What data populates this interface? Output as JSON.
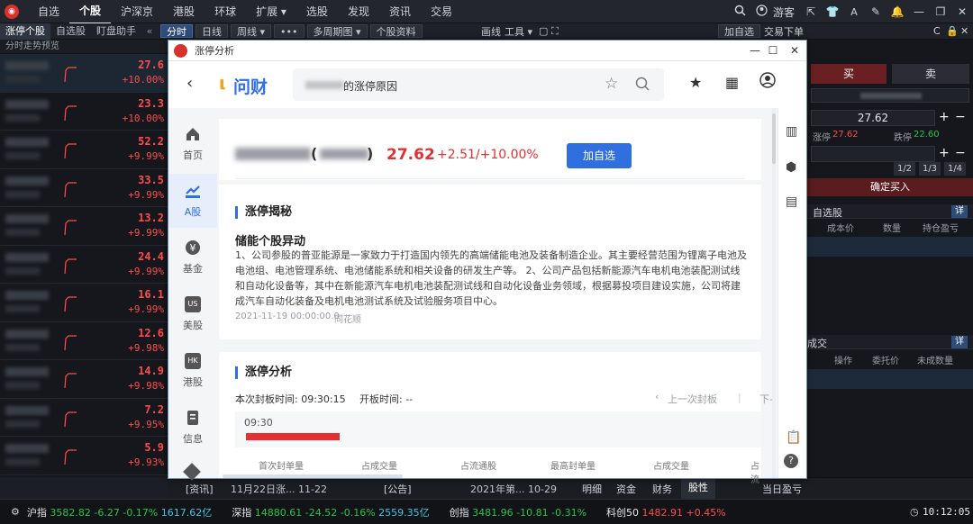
{
  "topbar": {
    "menu": [
      "自选",
      "个股",
      "沪深京",
      "港股",
      "环球",
      "扩展 ▾",
      "选股",
      "发现",
      "资讯",
      "交易"
    ],
    "active_index": 1,
    "user_label": "游客"
  },
  "row2": {
    "left_tabs": [
      "涨停个股",
      "自选股",
      "盯盘助手"
    ],
    "pills": [
      "分时",
      "日线",
      "周线 ▾",
      "•••",
      "多周期图 ▾",
      "个股资料"
    ],
    "right_items": [
      "画线",
      "工具 ▾",
      "▢",
      "⛶"
    ],
    "add_watch": "加自选",
    "trade_order": "交易下单"
  },
  "leftpanel": {
    "subheader": "分时走势预览",
    "rows": [
      {
        "price": "27.6",
        "pct": "+10.00%"
      },
      {
        "price": "23.3",
        "pct": "+10.00%"
      },
      {
        "price": "52.2",
        "pct": "+9.99%"
      },
      {
        "price": "33.5",
        "pct": "+9.99%"
      },
      {
        "price": "13.2",
        "pct": "+9.99%"
      },
      {
        "price": "24.4",
        "pct": "+9.99%"
      },
      {
        "price": "16.1",
        "pct": "+9.99%"
      },
      {
        "price": "12.6",
        "pct": "+9.98%"
      },
      {
        "price": "14.9",
        "pct": "+9.98%"
      },
      {
        "price": "7.2",
        "pct": "+9.95%"
      },
      {
        "price": "5.9",
        "pct": "+9.93%"
      }
    ]
  },
  "modal": {
    "title": "涨停分析",
    "brand": "问财",
    "search_text": "的涨停原因",
    "side_items": [
      "首页",
      "A股",
      "基金",
      "美股",
      "港股",
      "信息"
    ],
    "side_badges": {
      "us": "US",
      "hk": "HK"
    },
    "stock": {
      "price": "27.62",
      "change": "+2.51/+10.00%",
      "add_button": "加自选"
    },
    "card1": {
      "title": "涨停揭秘",
      "subtitle": "储能个股异动",
      "body": "1、公司参股的普亚能源是一家致力于打造国内领先的高端储能电池及装备制造企业。其主要经营范围为锂离子电池及电池组、电池管理系统、电池储能系统和相关设备的研发生产等。 2、公司产品包括新能源汽车电机电池装配测试线和自动化设备等，其中在新能源汽车电机电池装配测试线和自动化设备业务领域，根据募投项目建设实施，公司将建成汽车自动化装备及电机电池测试系统及试验服务项目中心。",
      "timestamp": "2021-11-19 00:00:00.0",
      "source": "同花顺"
    },
    "card2": {
      "title": "涨停分析",
      "seal_time": "本次封板时间: 09:30:15",
      "open_time": "开板时间: --",
      "prev_board": "上一次封板",
      "next_board": "下-",
      "chart_time": "09:30",
      "table_headers": [
        "首次封单量",
        "占成交量",
        "占流通股",
        "最高封单量",
        "占成交量",
        "占流"
      ]
    }
  },
  "rightpanel": {
    "buy": "买",
    "sell": "卖",
    "price_value": "27.62",
    "limit_up_label": "涨停",
    "limit_up_value": "27.62",
    "limit_down_label": "跌停",
    "limit_down_value": "22.60",
    "fractions": [
      "1/2",
      "1/3",
      "1/4"
    ],
    "confirm_buy": "确定买入",
    "holdings_title": "自选股",
    "detail": "详",
    "holdings_headers": [
      "成本价",
      "数量",
      "持仓盈亏"
    ],
    "deals_title": "成交",
    "deals_headers": [
      "操作",
      "委托价",
      "未成数量"
    ],
    "detail2": "详"
  },
  "newsbar": {
    "item1": "[资讯]",
    "item1_text": "11月22日涨... 11-22",
    "item2": "[公告]",
    "item2_text": "2021年第... 10-29",
    "tabs": [
      "明细",
      "资金",
      "财务",
      "股性"
    ],
    "active_tab": 3,
    "daily_pnl": "当日盈亏"
  },
  "statusbar": {
    "indices": [
      {
        "name": "沪指",
        "value": "3582.82",
        "change": "-6.27",
        "pct": "-0.17%",
        "amount": "1617.62亿",
        "dir": "down"
      },
      {
        "name": "深指",
        "value": "14880.61",
        "change": "-24.52",
        "pct": "-0.16%",
        "amount": "2559.35亿",
        "dir": "down"
      },
      {
        "name": "创指",
        "value": "3481.96",
        "change": "-10.81",
        "pct": "-0.31%",
        "amount": "",
        "dir": "down"
      },
      {
        "name": "科创50",
        "value": "1482.91",
        "change": "",
        "pct": "+0.45%",
        "amount": "",
        "dir": "up"
      }
    ],
    "time": "10:12:05"
  },
  "colors": {
    "accent_blue": "#2f6fe0",
    "rise_red": "#ff4c4c",
    "fall_green": "#27c44d"
  }
}
